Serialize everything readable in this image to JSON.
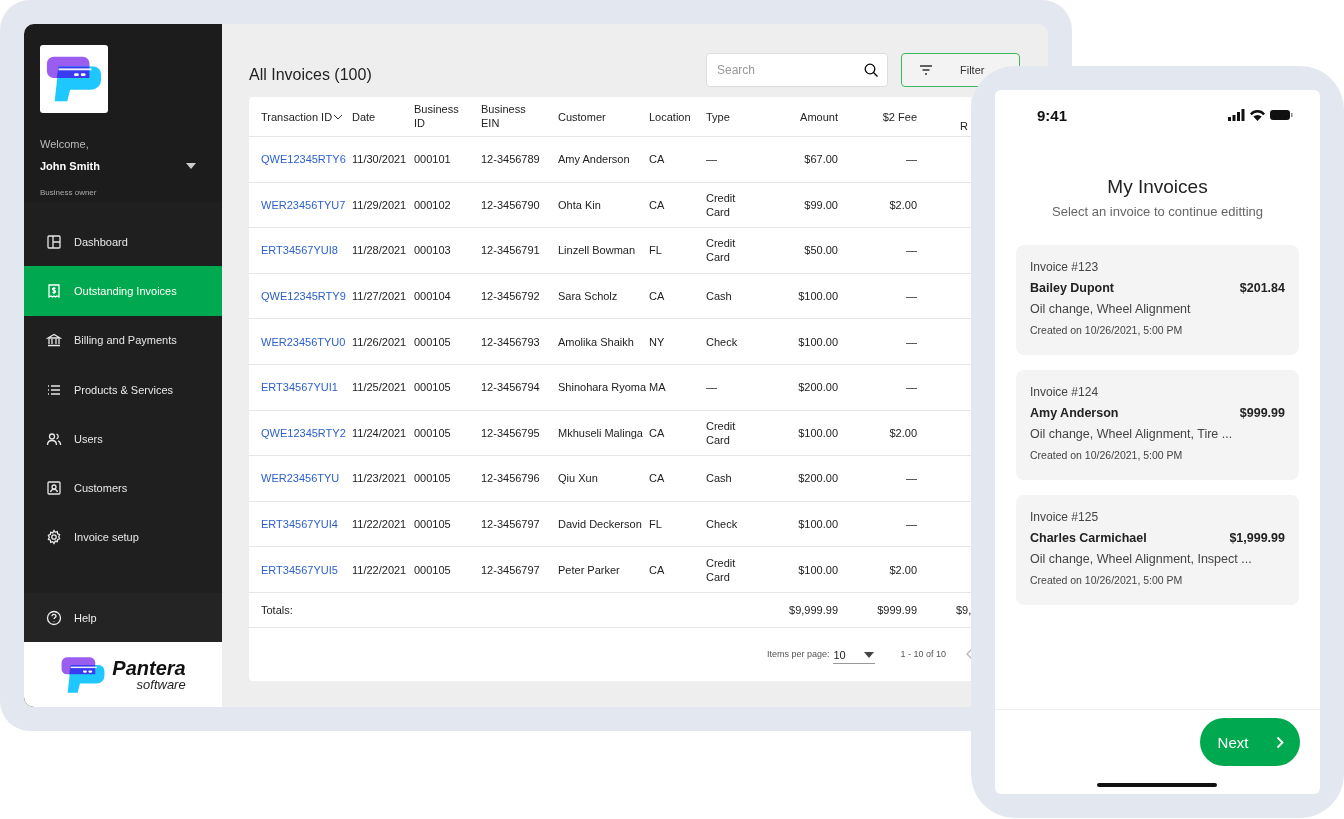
{
  "sidebar": {
    "welcome": "Welcome,",
    "user_name": "John Smith",
    "user_role": "Business owner",
    "items": [
      {
        "label": "Dashboard",
        "selected": false
      },
      {
        "label": "Outstanding Invoices",
        "selected": true
      },
      {
        "label": "Billing and Payments",
        "selected": false
      },
      {
        "label": "Products & Services",
        "selected": false
      },
      {
        "label": "Users",
        "selected": false
      },
      {
        "label": "Customers",
        "selected": false
      },
      {
        "label": "Invoice setup",
        "selected": false
      }
    ],
    "help": "Help",
    "brand": {
      "name": "Pantera",
      "tagline": "software"
    }
  },
  "main": {
    "title": "All Invoices (100)",
    "search": {
      "placeholder": "Search"
    },
    "filter_button": "Filter"
  },
  "table": {
    "columns": [
      "Transaction ID",
      "Date",
      "Business ID",
      "Business EIN",
      "Customer",
      "Location",
      "Type",
      "Amount",
      "$2 Fee",
      "R"
    ],
    "rows": [
      [
        "QWE12345RTY6",
        "11/30/2021",
        "000101",
        "12-3456789",
        "Amy Anderson",
        "CA",
        "—",
        "$67.00",
        "—"
      ],
      [
        "WER23456TYU7",
        "11/29/2021",
        "000102",
        "12-3456790",
        "Ohta Kin",
        "CA",
        "Credit Card",
        "$99.00",
        "$2.00"
      ],
      [
        "ERT34567YUI8",
        "11/28/2021",
        "000103",
        "12-3456791",
        "Linzell Bowman",
        "FL",
        "Credit Card",
        "$50.00",
        "—"
      ],
      [
        "QWE12345RTY9",
        "11/27/2021",
        "000104",
        "12-3456792",
        "Sara Scholz",
        "CA",
        "Cash",
        "$100.00",
        "—"
      ],
      [
        "WER23456TYU0",
        "11/26/2021",
        "000105",
        "12-3456793",
        "Amolika Shaikh",
        "NY",
        "Check",
        "$100.00",
        "—"
      ],
      [
        "ERT34567YUI1",
        "11/25/2021",
        "000105",
        "12-3456794",
        "Shinohara Ryoma",
        "MA",
        "—",
        "$200.00",
        "—"
      ],
      [
        "QWE12345RTY2",
        "11/24/2021",
        "000105",
        "12-3456795",
        "Mkhuseli Malinga",
        "CA",
        "Credit Card",
        "$100.00",
        "$2.00"
      ],
      [
        "WER23456TYU",
        "11/23/2021",
        "000105",
        "12-3456796",
        "Qiu Xun",
        "CA",
        "Cash",
        "$200.00",
        "—"
      ],
      [
        "ERT34567YUI4",
        "11/22/2021",
        "000105",
        "12-3456797",
        "David Deckerson",
        "FL",
        "Check",
        "$100.00",
        "—"
      ],
      [
        "ERT34567YUI5",
        "11/22/2021",
        "000105",
        "12-3456797",
        "Peter Parker",
        "CA",
        "Credit Card",
        "$100.00",
        "$2.00"
      ]
    ],
    "totals": {
      "label": "Totals:",
      "amount": "$9,999.99",
      "fee": "$999.99",
      "column_10": "$9,"
    },
    "pagination": {
      "items_label": "Items per page:",
      "items_value": "10",
      "range": "1 - 10 of 10"
    }
  },
  "phone": {
    "time": "9:41",
    "title": "My Invoices",
    "subtitle": "Select an invoice to continue editting",
    "invoices": [
      {
        "number": "Invoice #123",
        "customer": "Bailey Dupont",
        "amount": "$201.84",
        "services": "Oil change, Wheel Alignment",
        "created": "Created on 10/26/2021, 5:00 PM"
      },
      {
        "number": "Invoice #124",
        "customer": "Amy Anderson",
        "amount": "$999.99",
        "services": "Oil change, Wheel Alignment, Tire ...",
        "created": "Created on 10/26/2021, 5:00 PM"
      },
      {
        "number": "Invoice #125",
        "customer": "Charles Carmichael",
        "amount": "$1,999.99",
        "services": "Oil change, Wheel Alignment, Inspect ...",
        "created": "Created on 10/26/2021, 5:00 PM"
      }
    ],
    "next_button": "Next"
  }
}
